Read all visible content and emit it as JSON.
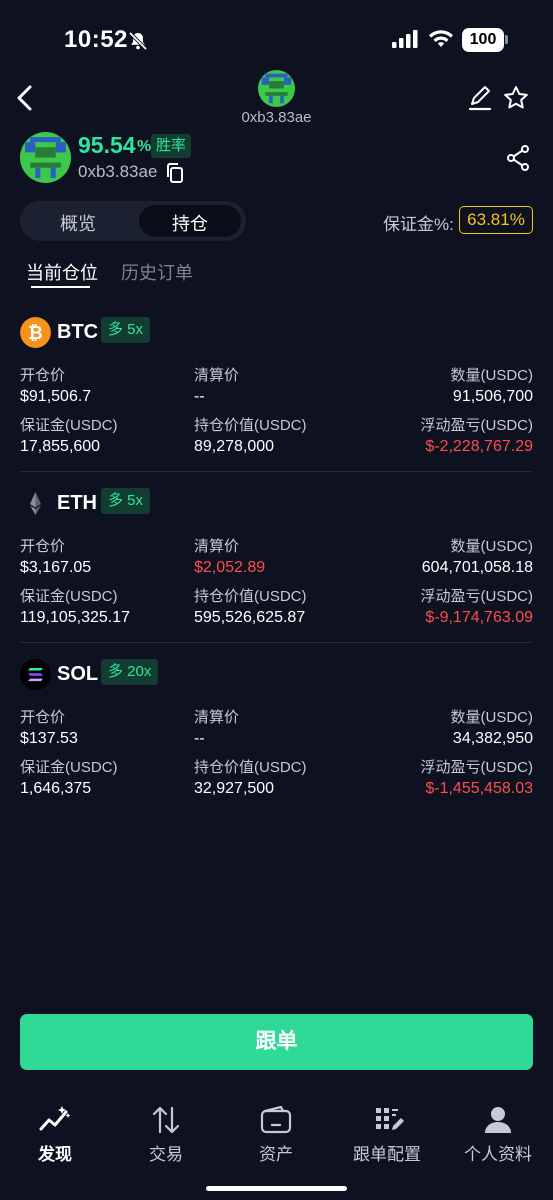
{
  "status_bar": {
    "time": "10:52",
    "battery": "100"
  },
  "header": {
    "address": "0xb3.83ae"
  },
  "profile": {
    "win_rate": "95.54",
    "win_rate_unit": "%",
    "win_rate_label": "胜率",
    "address": "0xb3.83ae"
  },
  "tabs": {
    "overview": "概览",
    "positions": "持仓"
  },
  "margin": {
    "label": "保证金%:",
    "value": "63.81%"
  },
  "sub_tabs": {
    "current": "当前仓位",
    "history": "历史订单"
  },
  "labels": {
    "open_price": "开仓价",
    "liq_price": "清算价",
    "quantity": "数量(USDC)",
    "margin": "保证金(USDC)",
    "position_value": "持仓价值(USDC)",
    "pnl": "浮动盈亏(USDC)"
  },
  "positions": [
    {
      "symbol": "BTC",
      "side": "多 5x",
      "open_price": "$91,506.7",
      "liq_price": "--",
      "quantity": "91,506,700",
      "margin": "17,855,600",
      "position_value": "89,278,000",
      "pnl": "$-2,228,767.29"
    },
    {
      "symbol": "ETH",
      "side": "多 5x",
      "open_price": "$3,167.05",
      "liq_price": "$2,052.89",
      "quantity": "604,701,058.18",
      "margin": "119,105,325.17",
      "position_value": "595,526,625.87",
      "pnl": "$-9,174,763.09"
    },
    {
      "symbol": "SOL",
      "side": "多 20x",
      "open_price": "$137.53",
      "liq_price": "--",
      "quantity": "34,382,950",
      "margin": "1,646,375",
      "position_value": "32,927,500",
      "pnl": "$-1,455,458.03"
    }
  ],
  "follow_button": "跟单",
  "nav": [
    {
      "label": "发现",
      "icon": "discover-icon"
    },
    {
      "label": "交易",
      "icon": "trade-icon"
    },
    {
      "label": "资产",
      "icon": "wallet-icon"
    },
    {
      "label": "跟单配置",
      "icon": "copy-config-icon"
    },
    {
      "label": "个人资料",
      "icon": "profile-icon"
    }
  ],
  "colors": {
    "background": "#0d1120",
    "accent": "#2ee59d",
    "loss": "#ff4d4d",
    "margin_badge": "#f5c518"
  }
}
